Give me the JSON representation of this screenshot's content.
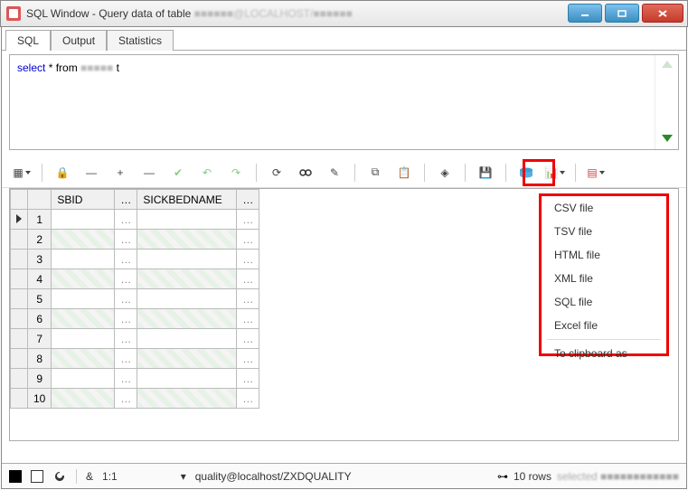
{
  "window": {
    "title_prefix": "SQL Window - Query data of table ",
    "title_obscured": "■■■■■■@LOCALHOST/■■■■■■",
    "minimize": "—",
    "maximize": "□",
    "close": "✕"
  },
  "tabs": {
    "sql": "SQL",
    "output": "Output",
    "statistics": "Statistics"
  },
  "sql": {
    "keyword_select": "select",
    "star_from": " * from ",
    "table_obscured": "■■■■■",
    "alias": " t"
  },
  "toolbar_icons": {
    "grid": "▦",
    "lock": "🔒",
    "minus": "―",
    "plus": "+",
    "dash": "—",
    "check": "✔",
    "undo": "↶",
    "redo": "↷",
    "refresh": "⟳",
    "find": "🔍",
    "edit": "✎",
    "copy": "⧉",
    "paste": "📋",
    "bookmark": "◈",
    "save": "💾",
    "export": "⬒",
    "chart": "📊",
    "tablelist": "▤"
  },
  "grid": {
    "headers": {
      "col1": "SBID",
      "col2": "SICKBEDNAME"
    },
    "row_count": 10,
    "row_numbers": [
      "1",
      "2",
      "3",
      "4",
      "5",
      "6",
      "7",
      "8",
      "9",
      "10"
    ],
    "dots": "…"
  },
  "export_menu": {
    "csv": "CSV file",
    "tsv": "TSV file",
    "html": "HTML file",
    "xml": "XML file",
    "sql": "SQL file",
    "excel": "Excel file",
    "clipboard": "To clipboard as"
  },
  "statusbar": {
    "amp": "&",
    "pos": "1:1",
    "connection": "quality@localhost/ZXDQUALITY",
    "rows_label": "10 rows ",
    "obscured": "selected ■■■■■■■■■■■■"
  }
}
